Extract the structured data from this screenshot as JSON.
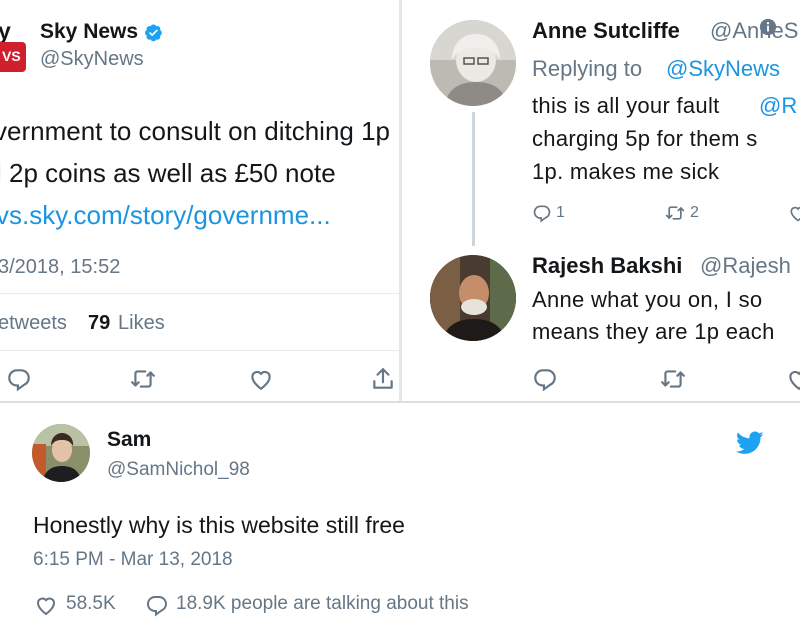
{
  "left_tweet": {
    "name": "Sky News",
    "name_partial": "y",
    "handle": "@SkyNews",
    "logo_text": "VS",
    "text_lines": [
      "vernment to consult on ditching 1p",
      "l 2p coins as well as £50 note"
    ],
    "link": "vs.sky.com/story/governme...",
    "timestamp": "3/2018, 15:52",
    "retweets_label": "etweets",
    "likes_count": "79",
    "likes_label": "Likes",
    "icons": [
      "reply-icon",
      "retweet-icon",
      "like-icon",
      "share-icon"
    ]
  },
  "right_thread": {
    "reply1": {
      "name": "Anne Sutcliffe",
      "handle": "@AnneS",
      "replying_to": "Replying to",
      "replying_handle": "@SkyNews",
      "text_lines": [
        "this is all your fault",
        "charging 5p for them s",
        "1p. makes me sick"
      ],
      "mention": "@R",
      "reply_count": "1",
      "retweet_count": "2"
    },
    "reply2": {
      "name": "Rajesh Bakshi",
      "handle": "@Rajesh",
      "text_lines": [
        "Anne what you on, I so",
        "means they are 1p each"
      ]
    }
  },
  "bottom_tweet": {
    "name": "Sam",
    "handle": "@SamNichol_98",
    "text": "Honestly why is this website still free",
    "timestamp": "6:15 PM - Mar 13, 2018",
    "likes": "58.5K",
    "talking": "18.9K people are talking about this",
    "brand_icon": "twitter-bird-icon"
  },
  "colors": {
    "link_blue": "#1b95e0",
    "text_dark": "#14171a",
    "text_grey": "#657786",
    "verified_blue": "#1da1f2",
    "sky_red": "#d1202d"
  }
}
